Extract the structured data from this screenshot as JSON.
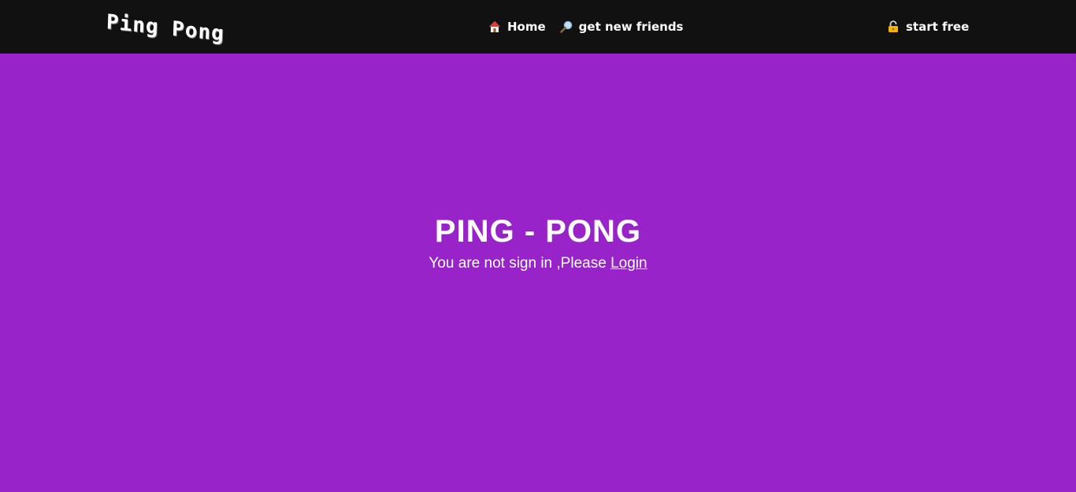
{
  "navbar": {
    "brand": "Ping Pong",
    "links": [
      {
        "label": "Home",
        "icon": "house-icon"
      },
      {
        "label": "get new friends",
        "icon": "magnifier-icon"
      }
    ],
    "cta": {
      "label": "start free",
      "icon": "lock-icon"
    }
  },
  "hero": {
    "title": "PING - PONG",
    "message": "You are not sign in ,Please ",
    "login_label": "Login"
  },
  "colors": {
    "background": "#9723c9",
    "navbar": "#111111",
    "text": "#ffffff"
  }
}
